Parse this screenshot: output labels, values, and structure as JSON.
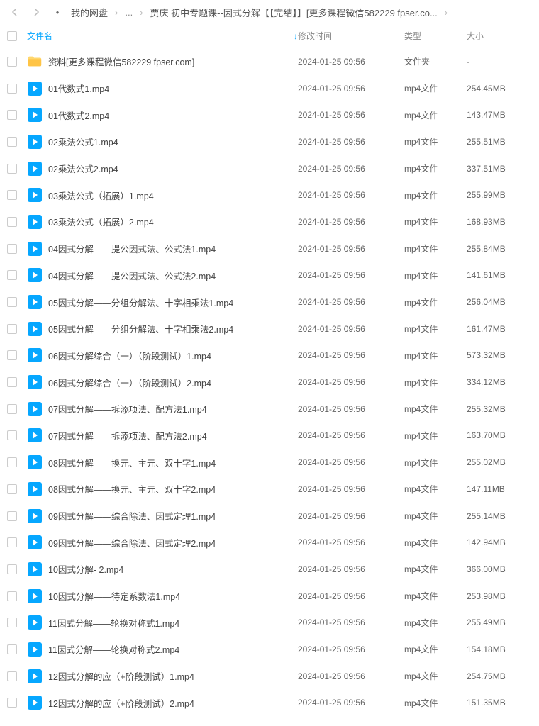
{
  "nav": {
    "root": "我的网盘",
    "dots": "...",
    "current": "贾庆 初中专题课--因式分解【【完结】】[更多课程微信582229 fpser.co..."
  },
  "columns": {
    "name": "文件名",
    "mtime": "修改时间",
    "type": "类型",
    "size": "大小"
  },
  "files": [
    {
      "icon": "folder",
      "name": "资料[更多课程微信582229 fpser.com]",
      "mtime": "2024-01-25 09:56",
      "type": "文件夹",
      "size": "-"
    },
    {
      "icon": "video",
      "name": "01代数式1.mp4",
      "mtime": "2024-01-25 09:56",
      "type": "mp4文件",
      "size": "254.45MB"
    },
    {
      "icon": "video",
      "name": "01代数式2.mp4",
      "mtime": "2024-01-25 09:56",
      "type": "mp4文件",
      "size": "143.47MB"
    },
    {
      "icon": "video",
      "name": "02乘法公式1.mp4",
      "mtime": "2024-01-25 09:56",
      "type": "mp4文件",
      "size": "255.51MB"
    },
    {
      "icon": "video",
      "name": "02乘法公式2.mp4",
      "mtime": "2024-01-25 09:56",
      "type": "mp4文件",
      "size": "337.51MB"
    },
    {
      "icon": "video",
      "name": "03乘法公式（拓展）1.mp4",
      "mtime": "2024-01-25 09:56",
      "type": "mp4文件",
      "size": "255.99MB"
    },
    {
      "icon": "video",
      "name": "03乘法公式（拓展）2.mp4",
      "mtime": "2024-01-25 09:56",
      "type": "mp4文件",
      "size": "168.93MB"
    },
    {
      "icon": "video",
      "name": "04因式分解——提公因式法、公式法1.mp4",
      "mtime": "2024-01-25 09:56",
      "type": "mp4文件",
      "size": "255.84MB"
    },
    {
      "icon": "video",
      "name": "04因式分解——提公因式法、公式法2.mp4",
      "mtime": "2024-01-25 09:56",
      "type": "mp4文件",
      "size": "141.61MB"
    },
    {
      "icon": "video",
      "name": "05因式分解——分组分解法、十字相乘法1.mp4",
      "mtime": "2024-01-25 09:56",
      "type": "mp4文件",
      "size": "256.04MB"
    },
    {
      "icon": "video",
      "name": "05因式分解——分组分解法、十字相乘法2.mp4",
      "mtime": "2024-01-25 09:56",
      "type": "mp4文件",
      "size": "161.47MB"
    },
    {
      "icon": "video",
      "name": "06因式分解综合（一）（阶段测试）1.mp4",
      "mtime": "2024-01-25 09:56",
      "type": "mp4文件",
      "size": "573.32MB"
    },
    {
      "icon": "video",
      "name": "06因式分解综合（一）（阶段测试）2.mp4",
      "mtime": "2024-01-25 09:56",
      "type": "mp4文件",
      "size": "334.12MB"
    },
    {
      "icon": "video",
      "name": "07因式分解——拆添项法、配方法1.mp4",
      "mtime": "2024-01-25 09:56",
      "type": "mp4文件",
      "size": "255.32MB"
    },
    {
      "icon": "video",
      "name": "07因式分解——拆添项法、配方法2.mp4",
      "mtime": "2024-01-25 09:56",
      "type": "mp4文件",
      "size": "163.70MB"
    },
    {
      "icon": "video",
      "name": "08因式分解——换元、主元、双十字1.mp4",
      "mtime": "2024-01-25 09:56",
      "type": "mp4文件",
      "size": "255.02MB"
    },
    {
      "icon": "video",
      "name": "08因式分解——换元、主元、双十字2.mp4",
      "mtime": "2024-01-25 09:56",
      "type": "mp4文件",
      "size": "147.11MB"
    },
    {
      "icon": "video",
      "name": "09因式分解——综合除法、因式定理1.mp4",
      "mtime": "2024-01-25 09:56",
      "type": "mp4文件",
      "size": "255.14MB"
    },
    {
      "icon": "video",
      "name": "09因式分解——综合除法、因式定理2.mp4",
      "mtime": "2024-01-25 09:56",
      "type": "mp4文件",
      "size": "142.94MB"
    },
    {
      "icon": "video",
      "name": "10因式分解- 2.mp4",
      "mtime": "2024-01-25 09:56",
      "type": "mp4文件",
      "size": "366.00MB"
    },
    {
      "icon": "video",
      "name": "10因式分解——待定系数法1.mp4",
      "mtime": "2024-01-25 09:56",
      "type": "mp4文件",
      "size": "253.98MB"
    },
    {
      "icon": "video",
      "name": "11因式分解——轮换对称式1.mp4",
      "mtime": "2024-01-25 09:56",
      "type": "mp4文件",
      "size": "255.49MB"
    },
    {
      "icon": "video",
      "name": "11因式分解——轮换对称式2.mp4",
      "mtime": "2024-01-25 09:56",
      "type": "mp4文件",
      "size": "154.18MB"
    },
    {
      "icon": "video",
      "name": "12因式分解的应（+阶段测试）1.mp4",
      "mtime": "2024-01-25 09:56",
      "type": "mp4文件",
      "size": "254.75MB"
    },
    {
      "icon": "video",
      "name": "12因式分解的应（+阶段测试）2.mp4",
      "mtime": "2024-01-25 09:56",
      "type": "mp4文件",
      "size": "151.35MB"
    }
  ]
}
